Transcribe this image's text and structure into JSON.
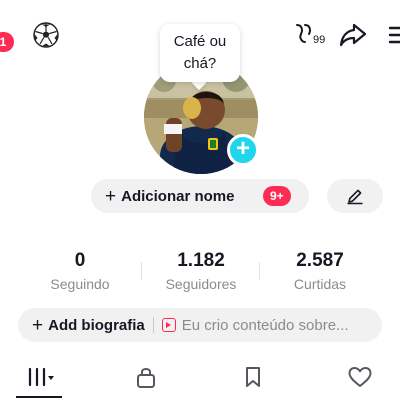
{
  "top_bar": {
    "notification_count": "1",
    "visitors_count": "99",
    "icons": [
      "add-friend-icon",
      "soccer-ball-icon",
      "profile-visitors-icon",
      "share-icon",
      "menu-icon"
    ]
  },
  "status_bubble": {
    "text": "Café ou chá?"
  },
  "profile": {
    "avatar_icon": "profile-photo",
    "add_name_label": "Adicionar nome",
    "add_name_badge": "9+",
    "edit_icon": "pencil-icon"
  },
  "stats": [
    {
      "value": "0",
      "label": "Seguindo"
    },
    {
      "value": "1.182",
      "label": "Seguidores"
    },
    {
      "value": "2.587",
      "label": "Curtidas"
    }
  ],
  "bio": {
    "add_label": "Add biografia",
    "preview_text": "Eu crio conteúdo sobre..."
  },
  "tabs": [
    {
      "name": "videos",
      "icon": "grid-icon",
      "active": true
    },
    {
      "name": "private",
      "icon": "lock-icon",
      "active": false
    },
    {
      "name": "favorites",
      "icon": "bookmark-icon",
      "active": false
    },
    {
      "name": "liked",
      "icon": "heart-icon",
      "active": false
    }
  ],
  "colors": {
    "accent_red": "#fe2c55",
    "accent_cyan": "#20d5ec",
    "text_primary": "#161823",
    "text_secondary": "#8a8b91",
    "pill_background": "#f1f1f2"
  }
}
